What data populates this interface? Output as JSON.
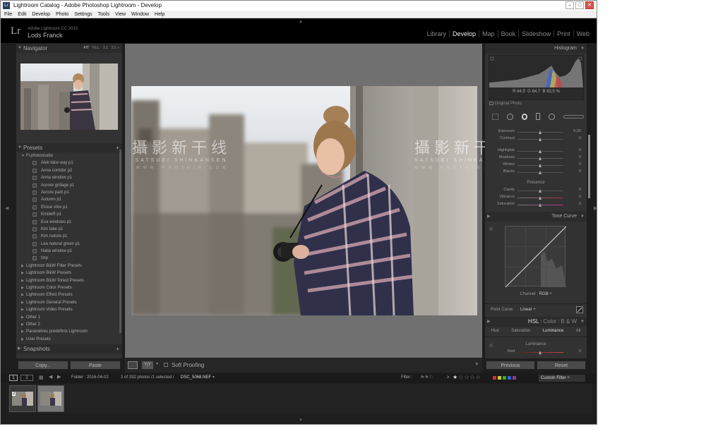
{
  "window": {
    "title": "Lightroom Catalog - Adobe Photoshop Lightroom - Develop",
    "icon_text": "Lr",
    "controls": [
      "–",
      "□",
      "✕"
    ]
  },
  "menu": [
    "File",
    "Edit",
    "Develop",
    "Photo",
    "Settings",
    "Tools",
    "View",
    "Window",
    "Help"
  ],
  "identity": {
    "logo": "Lr",
    "product": "Adobe Lightroom CC 2015",
    "catalog": "Lods Franck"
  },
  "modules": [
    "Library",
    "Develop",
    "Map",
    "Book",
    "Slideshow",
    "Print",
    "Web"
  ],
  "active_module": "Develop",
  "left_panel": {
    "navigator": {
      "title": "Navigator",
      "zoom_options": [
        "FIT",
        "FILL",
        "1:1",
        "3:1 ÷"
      ]
    },
    "presets": {
      "title": "Presets",
      "add": "+",
      "open_folder": "Fl-photostudio",
      "items": [
        "Alek b&w way p1",
        "Anna corridor p2",
        "Anna window p1",
        "Aurore grillage p1",
        "Aurore park p1",
        "Autumn p1",
        "Eloise vitre p1",
        "EmilieR p1",
        "Eva windows p1",
        "Kim lake p1",
        "Kim nature p1",
        "Lea natural green p1",
        "Natia window p1",
        "tmp"
      ],
      "folders": [
        "Lightroom B&W Filter Presets",
        "Lightroom B&W Presets",
        "Lightroom B&W Toned Presets",
        "Lightroom Color Presets",
        "Lightroom Effect Presets",
        "Lightroom General Presets",
        "Lightroom Video Presets",
        "Other 1",
        "Other 2",
        "Paramètres prédéfinis Lightroom",
        "User Presets"
      ]
    },
    "snapshots": {
      "title": "Snapshots",
      "add": "+"
    },
    "copy_label": "Copy...",
    "paste_label": "Paste"
  },
  "watermark": {
    "cn": "攝影新干线",
    "en": "SATSUEI SHINKANSEN",
    "url": "W W W . P H O T O I N . C O M"
  },
  "toolbar": {
    "soft_proofing": "Soft Proofing",
    "yy": "Y|Y"
  },
  "right_panel": {
    "histogram": {
      "title": "Histogram",
      "r_label": "R",
      "r_val": "64,9",
      "g_label": "G",
      "g_val": "64,7",
      "b_label": "B",
      "b_val": "63,5",
      "pct": "%",
      "original": "Original Photo"
    },
    "basic": {
      "sliders": [
        {
          "label": "Exposure",
          "value": "0,00"
        },
        {
          "label": "Contrast",
          "value": "0"
        },
        {
          "label": "Highlights",
          "value": "0"
        },
        {
          "label": "Shadows",
          "value": "0"
        },
        {
          "label": "Whites",
          "value": "0"
        },
        {
          "label": "Blacks",
          "value": "0"
        }
      ],
      "presence": "Presence",
      "presence_sliders": [
        {
          "label": "Clarity",
          "value": "0"
        },
        {
          "label": "Vibrance",
          "value": "0"
        },
        {
          "label": "Saturation",
          "value": "0"
        }
      ]
    },
    "tone_curve": {
      "title": "Tone Curve",
      "channel_label": "Channel :",
      "channel_value": "RGB ÷",
      "point_curve_label": "Point Curve :",
      "point_curve_value": "Linear ÷"
    },
    "hsl": {
      "tabs": [
        "HSL",
        "/",
        "Color",
        "/",
        "B & W"
      ],
      "subtabs": [
        "Hue",
        "Saturation",
        "Luminance",
        "All"
      ],
      "section": "Luminance",
      "first": {
        "label": "Red",
        "value": "0"
      }
    },
    "previous_label": "Previous",
    "reset_label": "Reset"
  },
  "filmstrip": {
    "screen1": "1",
    "screen2": "2",
    "folder": "Folder : 2016-04-02",
    "count": "2 of 332 photos /1 selected /",
    "filename": "DSC_5068.NEF",
    "filter_label": "Filter :",
    "rating_op": "≥",
    "custom_filter": "Custom Filter ÷",
    "thumb_badge": "2"
  },
  "colors": {
    "bg": "#1e1e1e",
    "panel": "#323232",
    "center_bg": "#707070",
    "active_module": "#eeeeee"
  }
}
